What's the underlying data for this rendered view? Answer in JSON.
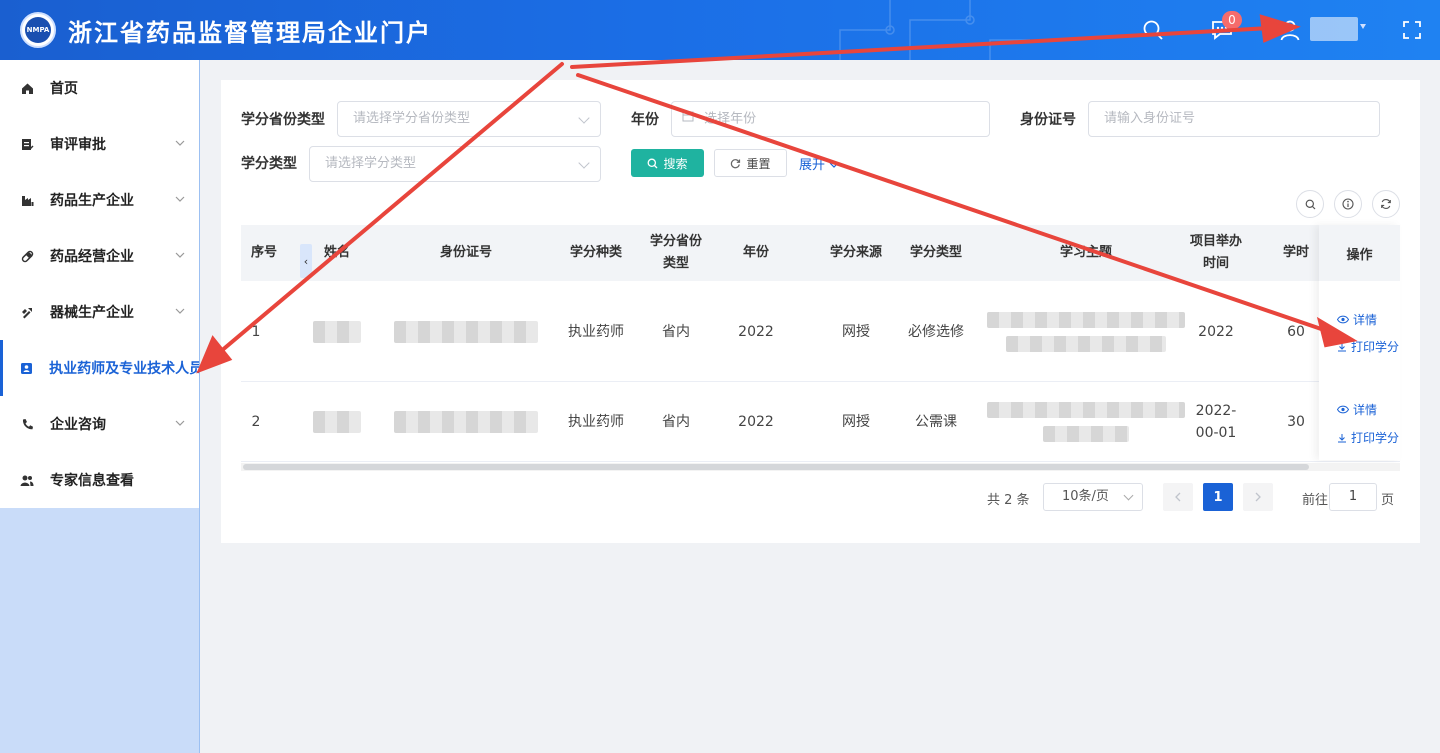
{
  "header": {
    "logo_text": "NMPA",
    "title": "浙江省药品监督管理局企业门户",
    "badge_count": "0"
  },
  "sidebar": {
    "items": [
      {
        "label": "首页",
        "icon": "home-icon"
      },
      {
        "label": "审评审批",
        "icon": "document-edit-icon"
      },
      {
        "label": "药品生产企业",
        "icon": "factory-icon"
      },
      {
        "label": "药品经营企业",
        "icon": "pill-icon"
      },
      {
        "label": "器械生产企业",
        "icon": "tools-icon"
      },
      {
        "label": "执业药师及专业技术人员",
        "icon": "id-card-icon"
      },
      {
        "label": "企业咨询",
        "icon": "phone-icon"
      },
      {
        "label": "专家信息查看",
        "icon": "users-icon"
      }
    ]
  },
  "filters": {
    "credit_province_type_label": "学分省份类型",
    "credit_province_type_placeholder": "请选择学分省份类型",
    "year_label": "年份",
    "year_placeholder": "选择年份",
    "id_number_label": "身份证号",
    "id_number_placeholder": "请输入身份证号",
    "credit_type_label": "学分类型",
    "credit_type_placeholder": "请选择学分类型",
    "search_label": "搜索",
    "reset_label": "重置",
    "expand_label": "展开"
  },
  "table": {
    "columns": {
      "index": "序号",
      "name": "姓名",
      "id_number": "身份证号",
      "credit_kind": "学分种类",
      "credit_province_type": "学分省份类型",
      "year": "年份",
      "credit_source": "学分来源",
      "credit_type": "学分类型",
      "topic": "学习主题",
      "project_time": "项目举办时间",
      "hours": "学时",
      "actions": "操作"
    },
    "rows": [
      {
        "index": "1",
        "credit_kind": "执业药师",
        "credit_province_type": "省内",
        "year": "2022",
        "credit_source": "网授",
        "credit_type": "必修选修",
        "project_time": "2022",
        "hours": "60"
      },
      {
        "index": "2",
        "credit_kind": "执业药师",
        "credit_province_type": "省内",
        "year": "2022",
        "credit_source": "网授",
        "credit_type": "公需课",
        "project_time": "2022-00-01",
        "hours": "30"
      }
    ],
    "action_detail": "详情",
    "action_print": "打印学分"
  },
  "pagination": {
    "total": "共 2 条",
    "page_size": "10条/页",
    "current_page": "1",
    "goto_label": "前往",
    "goto_value": "1",
    "page_suffix": "页"
  },
  "colors": {
    "header_blue": "#1b6ee6",
    "primary": "#1a62d6",
    "search_button": "#1fb3a0",
    "badge": "#f56c6c",
    "annotation_arrow": "#e8453c"
  }
}
